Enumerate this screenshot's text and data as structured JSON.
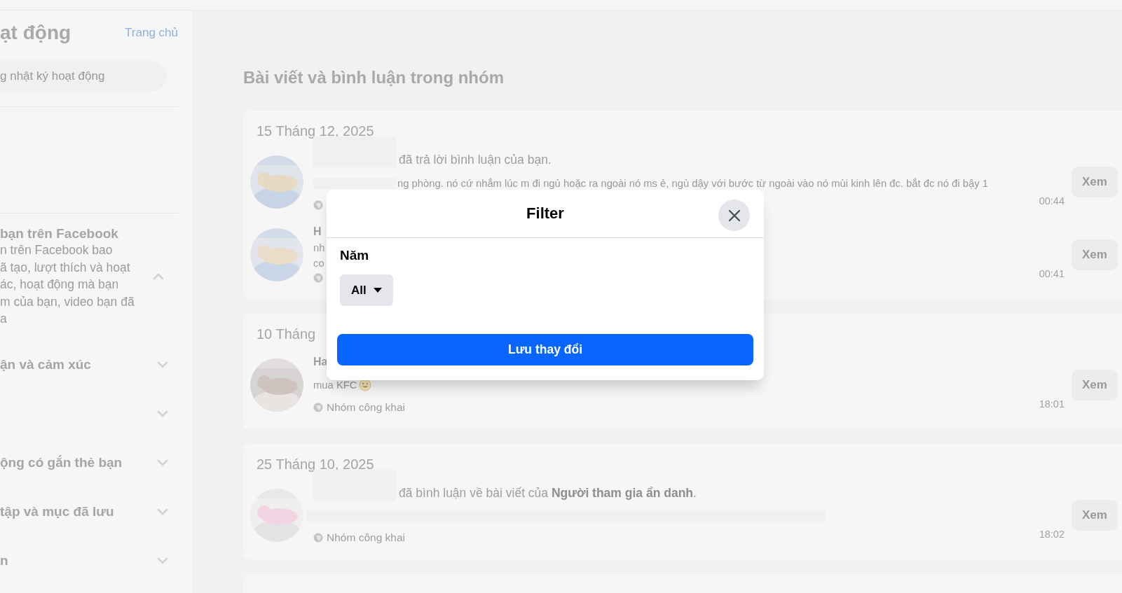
{
  "sidebar": {
    "title": "ạt động",
    "home_link": "Trang chủ",
    "search": {
      "placeholder": "g nhật ký hoạt động"
    },
    "sections": [
      {
        "title": "bạn trên Facebook",
        "lines": [
          "n trên Facebook bao",
          "ã tạo, lượt thích và hoạt",
          "ác, hoạt động mà bạn",
          "m của bạn, video bạn đã",
          "a"
        ],
        "expanded": true
      },
      {
        "title": "ận và cảm xúc",
        "expanded": false
      },
      {
        "expanded": false
      },
      {
        "title": "ộng có gắn thẻ bạn",
        "expanded": false
      },
      {
        "title": "tập và mục đã lưu",
        "expanded": false
      },
      {
        "title": "n",
        "expanded": false
      }
    ]
  },
  "main": {
    "heading": "Bài viết và bình luận trong nhóm",
    "groups": [
      {
        "date": "15 Tháng 12, 2025",
        "items": [
          {
            "name_hidden": true,
            "summary": "đã trả lời bình luận của bạn.",
            "excerpt_hidden": true,
            "excerpt": "ng phòng. nó cứ nhắm lúc m đi ngủ hoặc ra ngoài nó ms ẻ, ngủ dậy với bước từ ngoài vào nó mùi kinh lên đc. bắt đc nó đi bậy 1",
            "time": "00:44",
            "button": "Xem"
          },
          {
            "author": "H",
            "lines": [
              "nh",
              "co"
            ],
            "time": "00:41",
            "button": "Xem"
          }
        ]
      },
      {
        "date": "10 Tháng",
        "items": [
          {
            "author": "Ha",
            "excerpt": "mua KFC",
            "emoji": true,
            "audience": "Nhóm công khai",
            "time": "18:01",
            "button": "Xem"
          }
        ]
      },
      {
        "date": "25 Tháng 10, 2025",
        "items": [
          {
            "name_hidden": true,
            "summary": "đã bình luận về bài viết của **Người tham gia ẩn danh**.",
            "excerpt_hidden": true,
            "audience": "Nhóm công khai",
            "time": "18:02",
            "button": "Xem"
          }
        ]
      }
    ]
  },
  "dialog": {
    "title": "Filter",
    "field_label": "Năm",
    "select_value": "All",
    "save_button": "Lưu thay đổi"
  }
}
